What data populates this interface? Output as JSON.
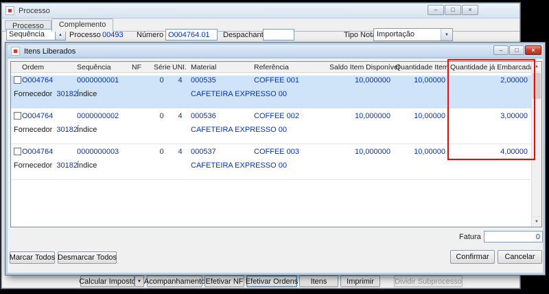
{
  "colors": {
    "data_text": "#0033cc",
    "selected_row": "#cfe4f8",
    "annotation": "#fe0000"
  },
  "icons": {
    "minimize": "–",
    "maximize": "□",
    "close": "×",
    "combo_arrow": "▼",
    "spinner_up": "▲",
    "scroll_up": "▲",
    "scroll_down": "▼"
  },
  "processo_window": {
    "title": "Processo",
    "tabs": {
      "processo": "Processo",
      "complemento": "Complemento"
    },
    "form": {
      "sequencia_label": "Sequência",
      "processo_label": "Processo",
      "processo_value": "00493",
      "numero_po_label": "Número PO",
      "numero_po_value": "O004764.01",
      "despachante_label": "Despachante",
      "despachante_value": "",
      "tipo_nota_label": "Tipo Nota",
      "tipo_nota_value": "Importação"
    },
    "toolbar": {
      "calcular_imposto": "Calcular Imposto",
      "acompanhamento": "Acompanhamento",
      "efetivar_nf": "Efetivar NF",
      "efetivar_ordens": "Efetivar Ordens",
      "itens": "Itens",
      "imprimir": "Imprimir",
      "dividir_subprocesso": "Dividir Subprocesso"
    }
  },
  "dialog": {
    "title": "Itens Liberados",
    "columns": [
      "Ordem",
      "Sequência",
      "NF",
      "Série",
      "UNI.",
      "Material",
      "Referência",
      "Saldo Item Disponível",
      "Quantidade Item",
      "Quantidade já Embarcada"
    ],
    "rows": [
      {
        "selected": true,
        "ordem": "O004764",
        "sequencia": "0000000001",
        "nf": "",
        "serie": "0",
        "uni": "4",
        "material": "000535",
        "referencia": "COFFEE 001",
        "saldo_item_disponivel": "10,000000",
        "quantidade_item": "10,00000",
        "quantidade_ja_embarcada": "2,00000",
        "fornecedor_label": "Fornecedor",
        "fornecedor_value": "30182",
        "indice_label": "Índice",
        "material_descricao": "CAFETEIRA EXPRESSO 00"
      },
      {
        "selected": false,
        "ordem": "O004764",
        "sequencia": "0000000002",
        "nf": "",
        "serie": "0",
        "uni": "4",
        "material": "000536",
        "referencia": "COFFEE 002",
        "saldo_item_disponivel": "10,000000",
        "quantidade_item": "10,00000",
        "quantidade_ja_embarcada": "3,00000",
        "fornecedor_label": "Fornecedor",
        "fornecedor_value": "30182",
        "indice_label": "Índice",
        "material_descricao": "CAFETEIRA EXPRESSO 00"
      },
      {
        "selected": false,
        "ordem": "O004764",
        "sequencia": "0000000003",
        "nf": "",
        "serie": "0",
        "uni": "4",
        "material": "000537",
        "referencia": "COFFEE 003",
        "saldo_item_disponivel": "10,000000",
        "quantidade_item": "10,00000",
        "quantidade_ja_embarcada": "4,00000",
        "fornecedor_label": "Fornecedor",
        "fornecedor_value": "30182",
        "indice_label": "Índice",
        "material_descricao": "CAFETEIRA EXPRESSO 00"
      }
    ],
    "fatura_label": "Fatura",
    "fatura_value": "0",
    "buttons": {
      "marcar_todos": "Marcar Todos",
      "desmarcar_todos": "Desmarcar Todos",
      "confirmar": "Confirmar",
      "cancelar": "Cancelar"
    }
  }
}
